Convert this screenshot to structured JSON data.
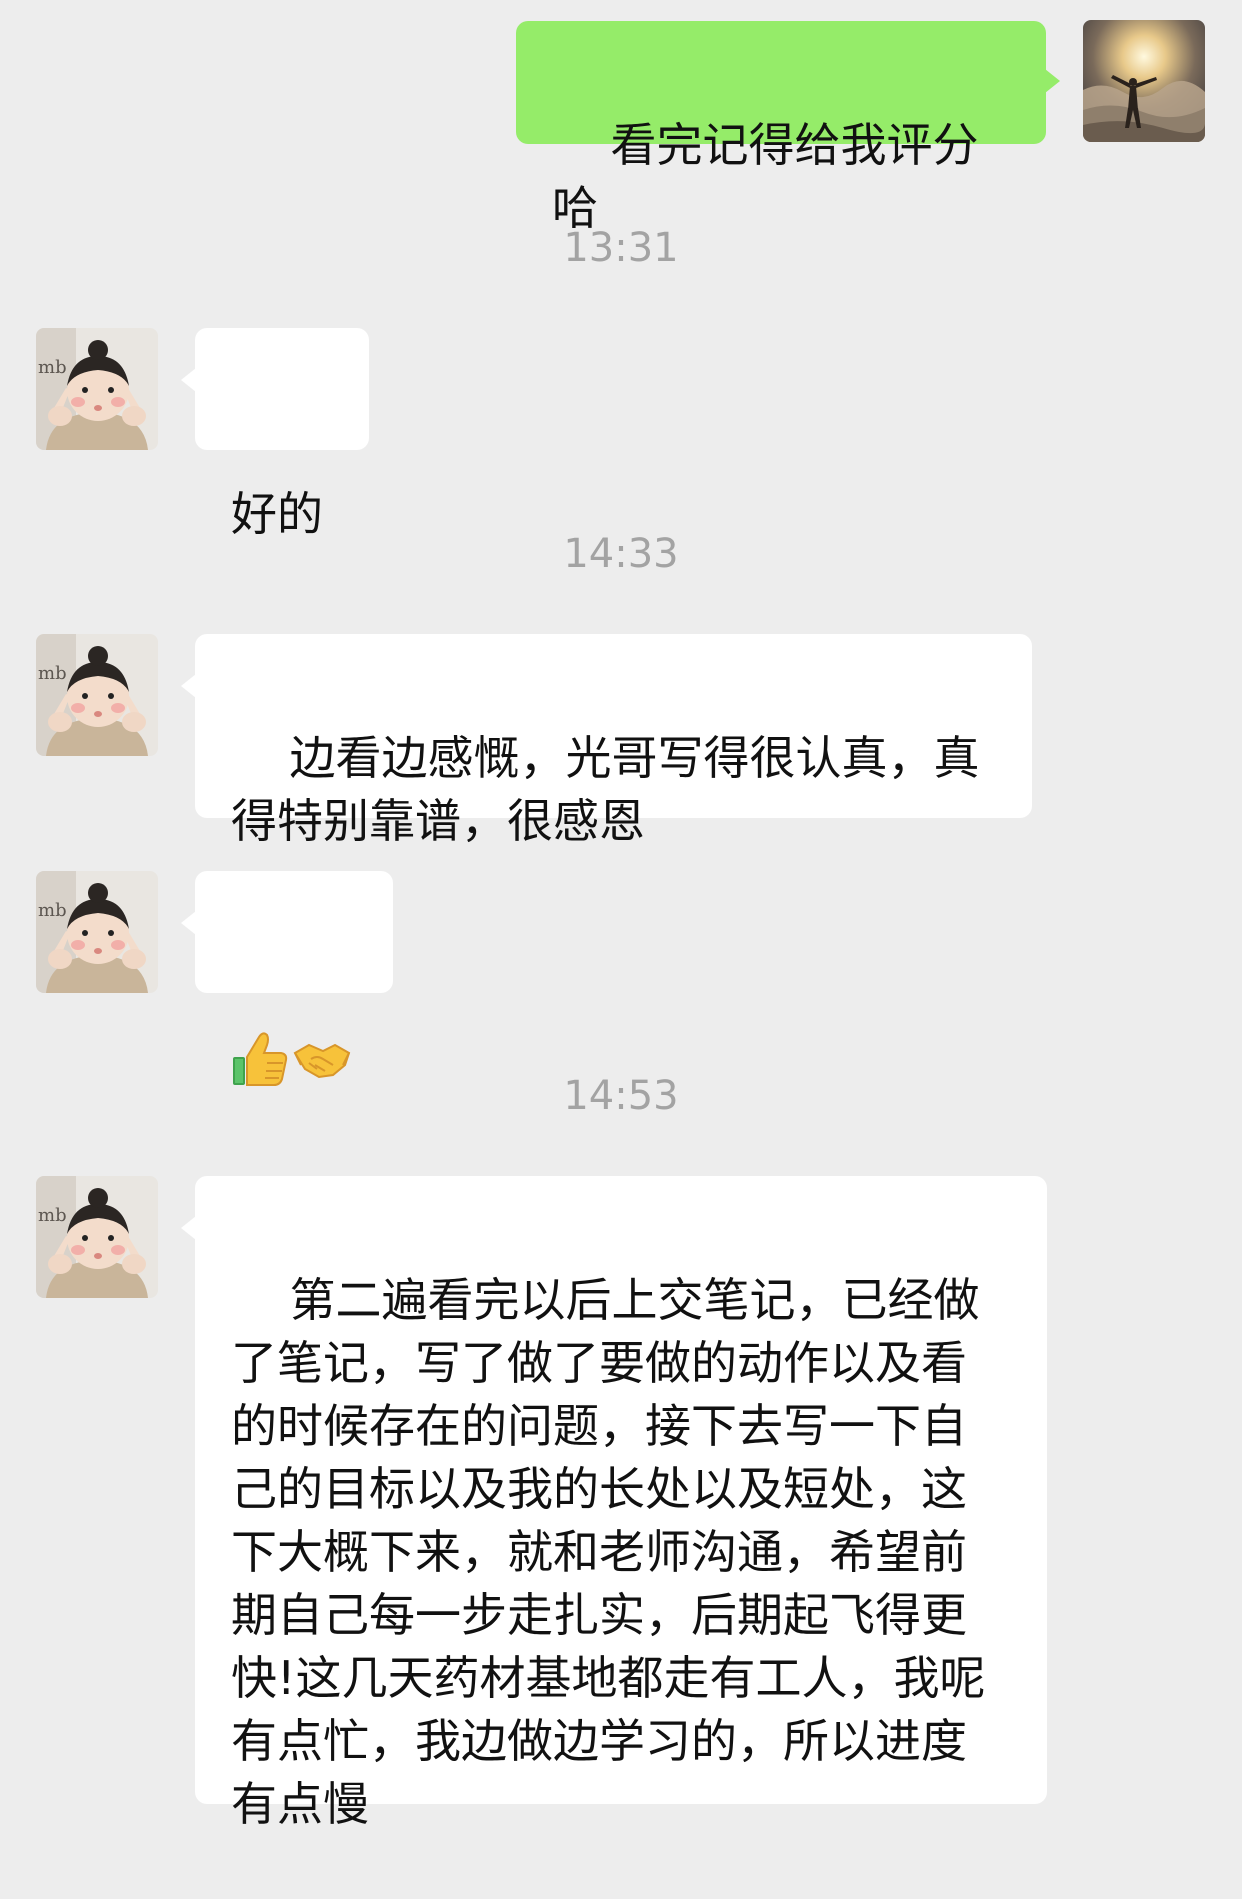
{
  "messages": {
    "m1": {
      "sender": "me",
      "text": "看完记得给我评分哈"
    },
    "t1": "13:31",
    "m2": {
      "sender": "contact",
      "text": "好的"
    },
    "t2": "14:33",
    "m3": {
      "sender": "contact",
      "text": "边看边感慨，光哥写得很认真，真得特别靠谱，很感恩"
    },
    "m4": {
      "sender": "contact",
      "emojis": [
        "thumbs-up",
        "handshake"
      ]
    },
    "t3": "14:53",
    "m5": {
      "sender": "contact",
      "text": "第二遍看完以后上交笔记，已经做了笔记，写了做了要做的动作以及看的时候存在的问题，接下去写一下自己的目标以及我的长处以及短处，这下大概下来，就和老师沟通，希望前期自己每一步走扎实，后期起飞得更快!这几天药材基地都走有工人，我呢有点忙，我边做边学习的，所以进度有点慢"
    }
  },
  "colors": {
    "background": "#ededed",
    "outgoing_bubble": "#95ec69",
    "incoming_bubble": "#ffffff",
    "timestamp": "#a3a3a3"
  }
}
